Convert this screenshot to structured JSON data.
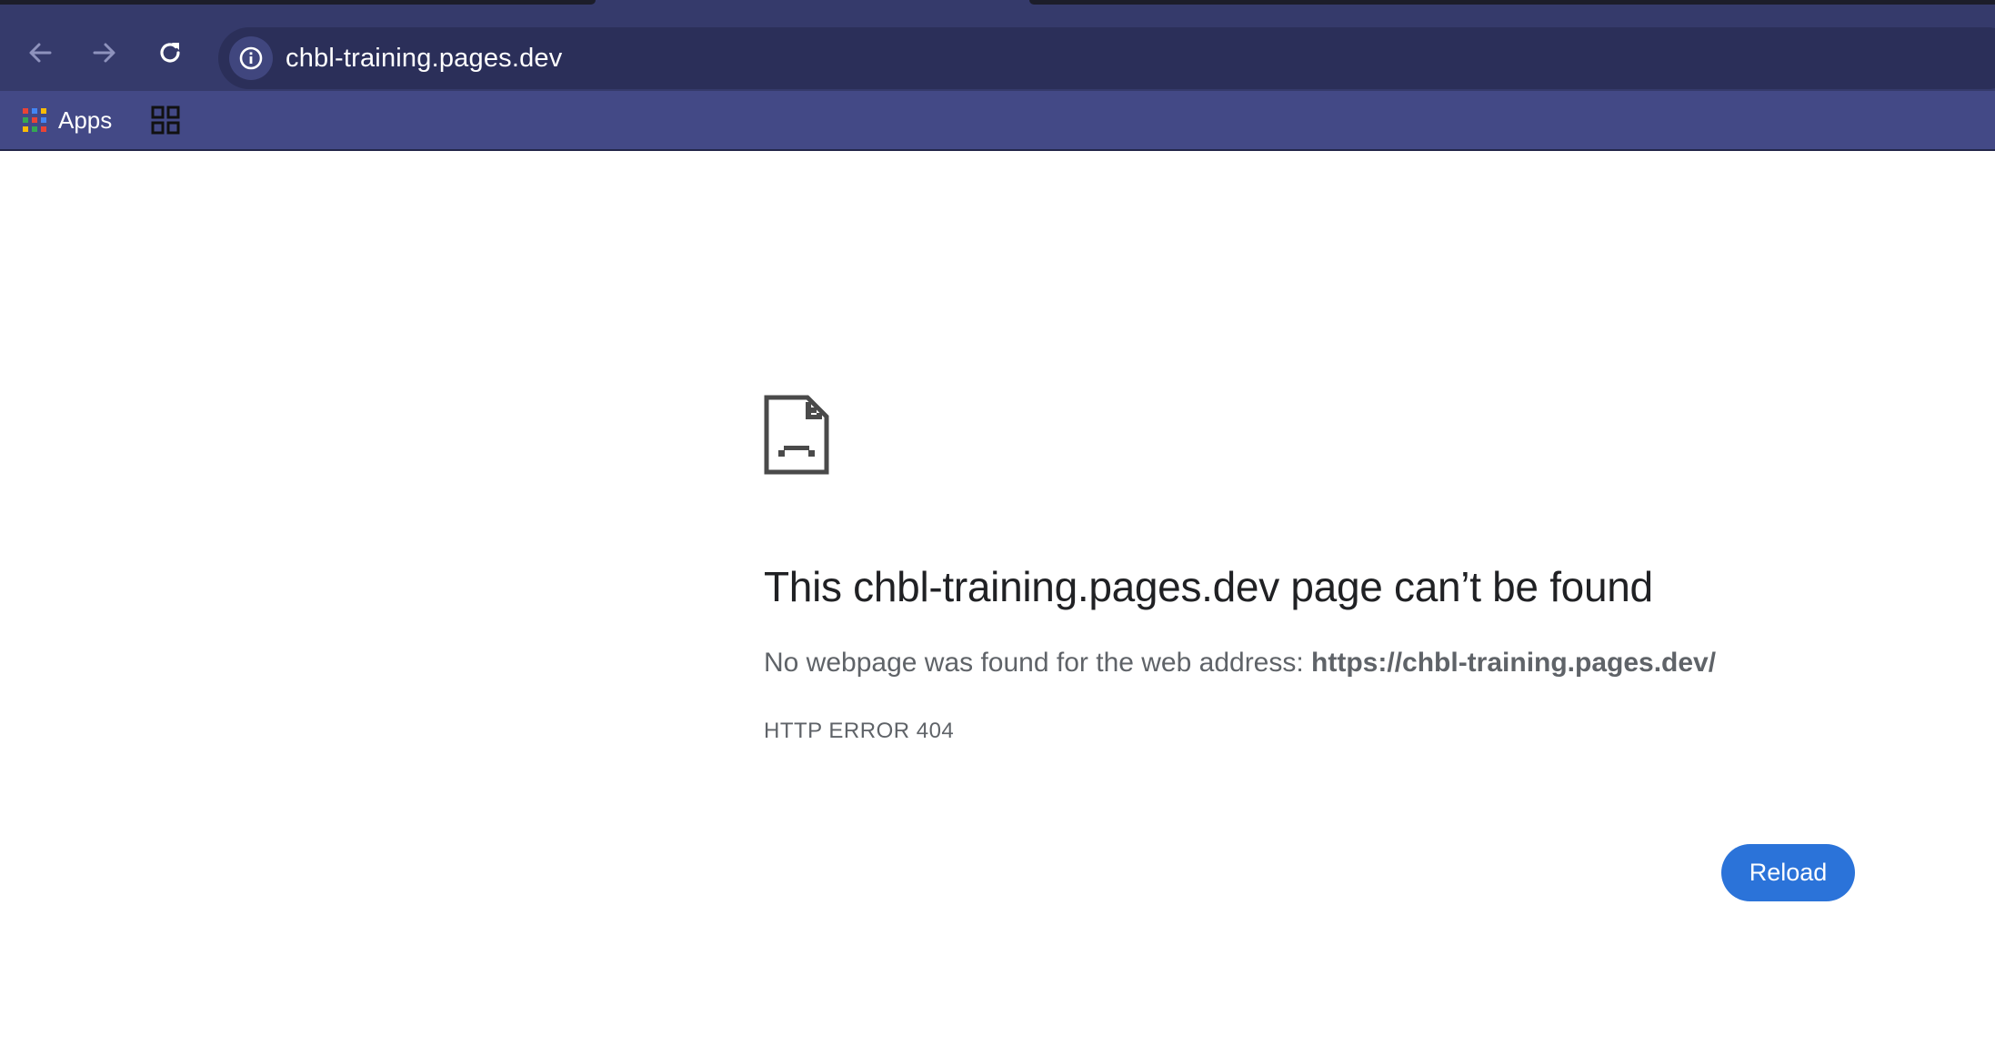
{
  "browser": {
    "url": "chbl-training.pages.dev",
    "icons": {
      "back": "arrow-left-icon",
      "forward": "arrow-right-icon",
      "reload": "reload-icon",
      "site_info": "info-icon"
    }
  },
  "bookmarks": {
    "apps_label": "Apps",
    "apps_icon": "apps-grid-icon",
    "second_icon": "tab-groups-icon"
  },
  "error_page": {
    "icon": "sad-page-icon",
    "title": "This chbl-training.pages.dev page can’t be found",
    "description_prefix": "No webpage was found for the web address:",
    "description_url": "https://chbl-training.pages.dev/",
    "error_code": "HTTP ERROR 404",
    "reload_label": "Reload"
  },
  "colors": {
    "toolbar": "#353a6b",
    "bookmarks_bar": "#434986",
    "reload_button": "#2b73d9",
    "title_text": "#202124",
    "body_text": "#5f6368"
  }
}
